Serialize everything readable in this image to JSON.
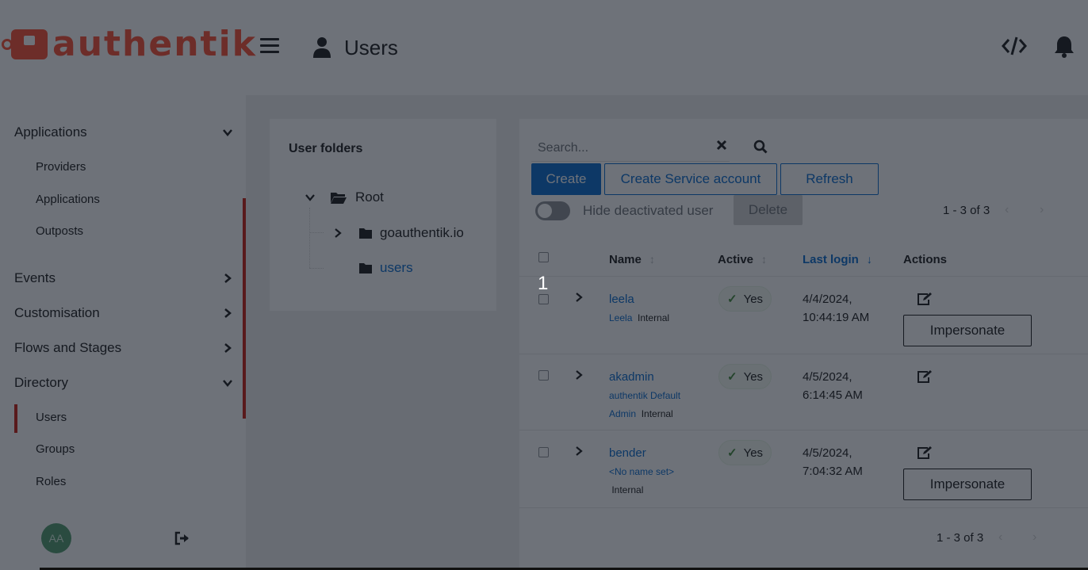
{
  "brand": {
    "name": "authentik",
    "color": "#fd4b2d"
  },
  "header": {
    "title": "Users"
  },
  "sidebar": {
    "sections": [
      {
        "label": "Applications",
        "expanded": true,
        "items": [
          "Providers",
          "Applications",
          "Outposts"
        ]
      },
      {
        "label": "Events",
        "expanded": false
      },
      {
        "label": "Customisation",
        "expanded": false
      },
      {
        "label": "Flows and Stages",
        "expanded": false
      },
      {
        "label": "Directory",
        "expanded": true,
        "items": [
          "Users",
          "Groups",
          "Roles"
        ]
      }
    ],
    "active_item": "Users",
    "avatar_initials": "AA"
  },
  "folders": {
    "title": "User folders",
    "root": "Root",
    "children": [
      "goauthentik.io",
      "users"
    ]
  },
  "toolbar": {
    "search_placeholder": "Search...",
    "create": "Create",
    "create_service": "Create Service account",
    "refresh": "Refresh",
    "hide_deactivated": "Hide deactivated user",
    "delete": "Delete",
    "pagination": "1 - 3 of 3"
  },
  "table": {
    "columns": [
      "Name",
      "Active",
      "Last login",
      "Actions"
    ],
    "rows": [
      {
        "username": "leela",
        "name": "Leela",
        "type": "Internal",
        "active": "Yes",
        "login_date": "4/4/2024,",
        "login_time": "10:44:19 AM",
        "impersonate": "Impersonate"
      },
      {
        "username": "akadmin",
        "name_line1": "authentik Default",
        "name_line2": "Admin",
        "type": "Internal",
        "active": "Yes",
        "login_date": "4/5/2024,",
        "login_time": "6:14:45 AM"
      },
      {
        "username": "bender",
        "name": "<No name set>",
        "type": "Internal",
        "active": "Yes",
        "login_date": "4/5/2024,",
        "login_time": "7:04:32 AM",
        "impersonate": "Impersonate"
      }
    ],
    "footer_pagination": "1 - 3 of 3"
  },
  "overlay": {
    "step": "1"
  }
}
